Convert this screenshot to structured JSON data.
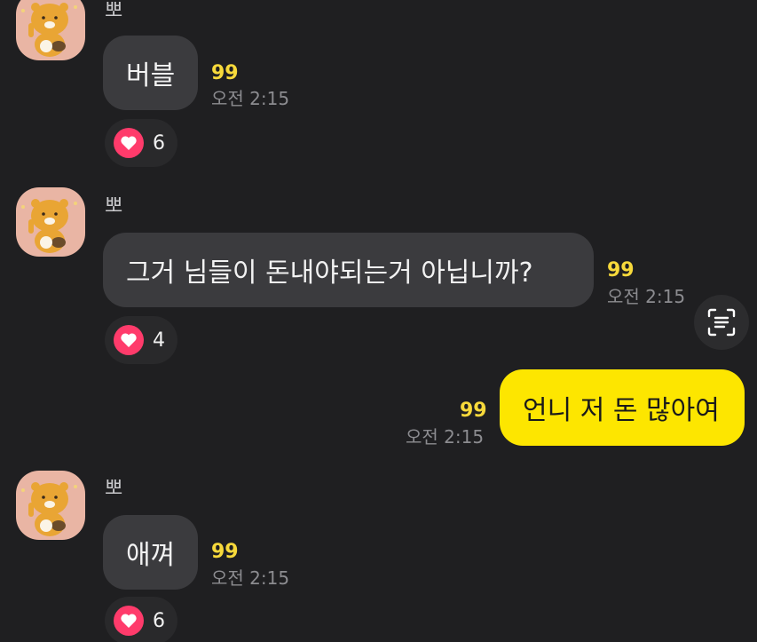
{
  "messages": [
    {
      "sender": "뽀",
      "text": "버블",
      "unread": "99",
      "time": "오전 2:15",
      "reaction_count": "6"
    },
    {
      "sender": "뽀",
      "text": "그거 님들이 돈내야되는거 아닙니까?",
      "unread": "99",
      "time": "오전 2:15",
      "reaction_count": "4"
    },
    {
      "sender": "me",
      "text": "언니 저 돈 많아여",
      "unread": "99",
      "time": "오전 2:15"
    },
    {
      "sender": "뽀",
      "text": "애껴",
      "unread": "99",
      "time": "오전 2:15",
      "reaction_count": "6"
    }
  ],
  "icons": {
    "reaction": "heart-icon",
    "scan": "text-scan-icon",
    "avatar": "ryan-character-icon"
  },
  "colors": {
    "background": "#1f1f21",
    "other_bubble": "#3b3b3e",
    "my_bubble": "#fde600",
    "unread": "#f7d93b",
    "heart": "#ff3b6b"
  }
}
